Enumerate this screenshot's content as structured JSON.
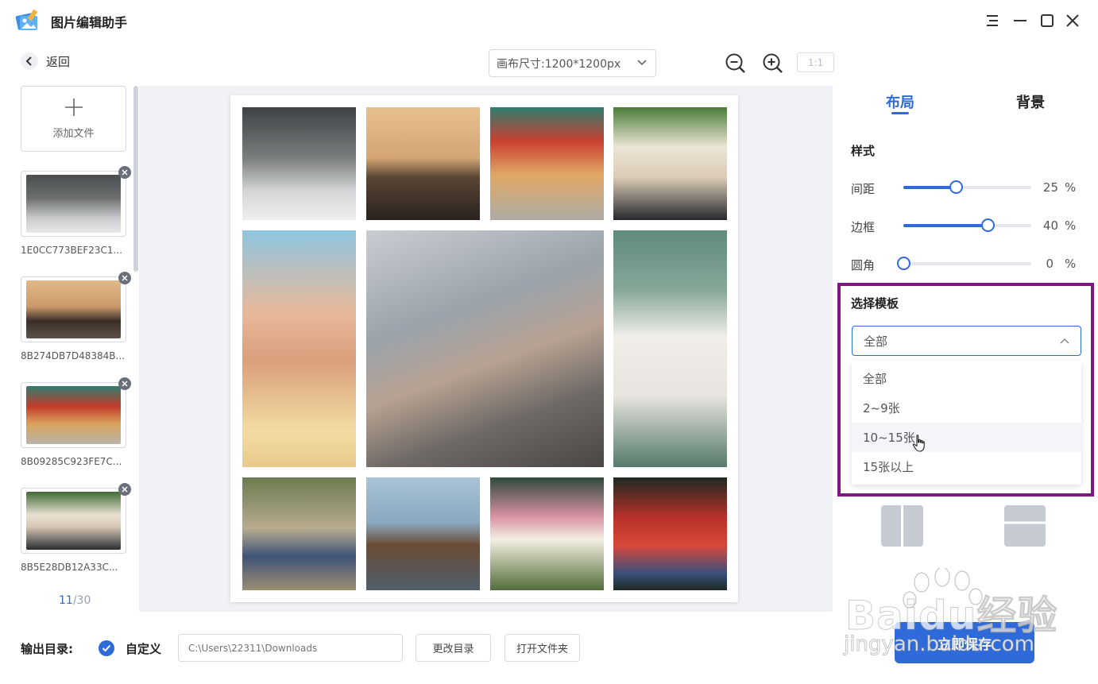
{
  "app": {
    "title": "图片编辑助手"
  },
  "toolbar": {
    "back_label": "返回",
    "canvas_size": "画布尺寸:1200*1200px",
    "ratio_label": "1:1"
  },
  "files": {
    "add_label": "添加文件",
    "items": [
      {
        "name": "1E0CC773BEF23C1..."
      },
      {
        "name": "8B274DB7D48384B..."
      },
      {
        "name": "8B09285C923FE7C..."
      },
      {
        "name": "8B5E28DB12A33C..."
      }
    ],
    "current": "11",
    "total": "/30"
  },
  "right_panel": {
    "tabs": [
      {
        "label": "布局"
      },
      {
        "label": "背景"
      }
    ],
    "style_title": "样式",
    "sliders": [
      {
        "label": "间距",
        "value": 25,
        "display": "25",
        "unit": "%"
      },
      {
        "label": "边框",
        "value": 40,
        "display": "40",
        "unit": "%"
      },
      {
        "label": "圆角",
        "value": 0,
        "display": "0",
        "unit": "%"
      }
    ],
    "template_title": "选择模板",
    "template_selected": "全部",
    "template_options": [
      "全部",
      "2~9张",
      "10~15张",
      "15张以上"
    ]
  },
  "footer": {
    "output_label": "输出目录:",
    "custom_label": "自定义",
    "path_placeholder": "C:\\Users\\22311\\Downloads",
    "change_dir_label": "更改目录",
    "open_folder_label": "打开文件夹",
    "save_label": "立即保存"
  },
  "watermark": {
    "line1": "Baidu经验",
    "line2": "jingyan.baidu.com"
  },
  "colors": {
    "accent": "#2f6bd8",
    "highlight": "#7e1780"
  }
}
